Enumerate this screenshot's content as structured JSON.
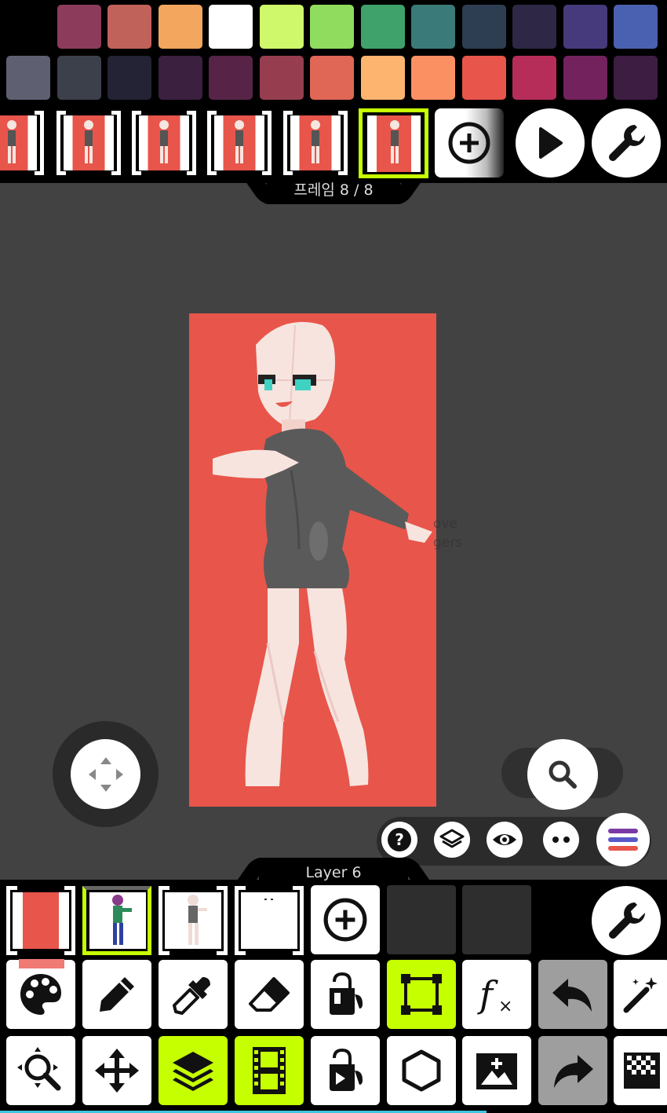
{
  "palette": {
    "row1": [
      "#000000",
      "#8c3b5a",
      "#c0625a",
      "#f2a65e",
      "#ffffff",
      "#cff86a",
      "#8fdc5e",
      "#3fa26a",
      "#3a7a78",
      "#2d3e53",
      "#2f2746",
      "#463a7c",
      "#4a60b0"
    ],
    "row2": [
      "#5e6072",
      "#3c404a",
      "#242335",
      "#3b2040",
      "#572448",
      "#963e4f",
      "#e06756",
      "#fdb46f",
      "#fb9063",
      "#e8554a",
      "#b72d59",
      "#73225e",
      "#3d1d42"
    ]
  },
  "frames": {
    "count": 6,
    "active_index": 5,
    "label": "프레임 8 / 8",
    "add_icon": "plus-circle-icon",
    "play_icon": "play-icon",
    "settings_icon": "wrench-icon"
  },
  "canvas": {
    "background": "#e8554a",
    "ghost_text_line1": "ove",
    "ghost_text_line2": "gers"
  },
  "controls": {
    "dpad_icon": "move-arrows-icon",
    "zoom_icon": "search-icon",
    "mini": [
      "help-icon",
      "layers-icon",
      "eye-icon",
      "more-dots-icon"
    ],
    "menu_icon": "menu-lines-icon"
  },
  "layers": {
    "label": "Layer 6",
    "active_index": 1,
    "thumb_icons": [
      "red-layer-thumb",
      "character-color-thumb",
      "character-sketch-thumb",
      "blank-layer-thumb"
    ],
    "add_icon": "plus-circle-icon",
    "settings_icon": "wrench-icon"
  },
  "tools": {
    "row1": [
      "palette-icon",
      "pencil-icon",
      "eyedropper-icon",
      "eraser-icon",
      "fill-bucket-icon",
      "select-rect-icon",
      "function-icon",
      "undo-icon",
      "magic-wand-icon"
    ],
    "row2": [
      "zoom-tool-icon",
      "move-icon",
      "layers-icon",
      "film-icon",
      "fill-pattern-icon",
      "hexagon-icon",
      "image-add-icon",
      "redo-icon",
      "checker-icon"
    ],
    "highlight_color": "#c6ff00"
  }
}
